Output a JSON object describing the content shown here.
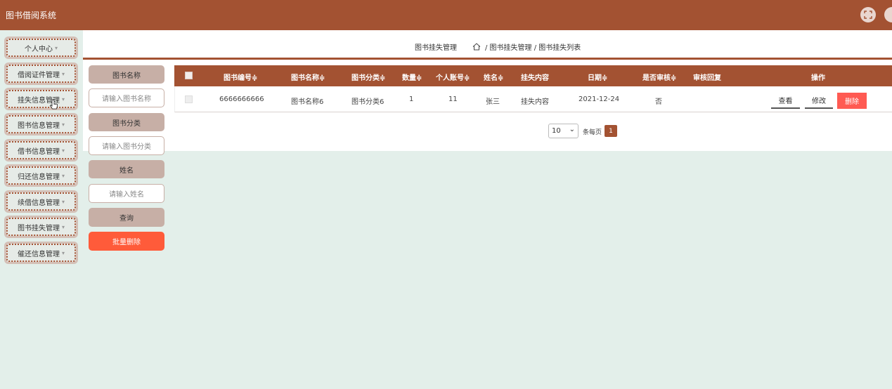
{
  "app": {
    "title": "图书借阅系统"
  },
  "breadcrumb": {
    "title": "图书挂失管理",
    "home_icon": "home-icon",
    "path": "/ 图书挂失管理 / 图书挂失列表"
  },
  "sidebar": {
    "items": [
      {
        "label": "个人中心"
      },
      {
        "label": "借阅证件管理"
      },
      {
        "label": "挂失信息管理"
      },
      {
        "label": "图书信息管理"
      },
      {
        "label": "借书信息管理"
      },
      {
        "label": "归还信息管理"
      },
      {
        "label": "续借信息管理"
      },
      {
        "label": "图书挂失管理"
      },
      {
        "label": "催还信息管理"
      }
    ]
  },
  "filters": {
    "book_name_label": "图书名称",
    "book_name_placeholder": "请输入图书名称",
    "book_category_label": "图书分类",
    "book_category_placeholder": "请输入图书分类",
    "name_label": "姓名",
    "name_placeholder": "请输入姓名",
    "query_label": "查询",
    "batch_delete_label": "批量删除"
  },
  "table": {
    "headers": {
      "book_id": "图书编号≑",
      "book_name": "图书名称≑",
      "book_category": "图书分类≑",
      "quantity": "数量≑",
      "account": "个人账号≑",
      "name": "姓名≑",
      "loss_content": "挂失内容",
      "date": "日期≑",
      "approved": "是否审核≑",
      "reply": "审核回复",
      "actions": "操作"
    },
    "rows": [
      {
        "book_id": "6666666666",
        "book_name": "图书名称6",
        "book_category": "图书分类6",
        "quantity": "1",
        "account": "11",
        "name": "张三",
        "loss_content": "挂失内容",
        "date": "2021-12-24",
        "approved": "否",
        "reply": "",
        "view": "查看",
        "edit": "修改",
        "delete": "删除"
      }
    ]
  },
  "pagination": {
    "page_size": "10",
    "per_page_label": "条每页",
    "current_page": "1"
  },
  "colors": {
    "brand": "#a35232",
    "background": "#e3efea",
    "delete": "#ff5a52",
    "batch_delete": "#ff5b3a"
  }
}
